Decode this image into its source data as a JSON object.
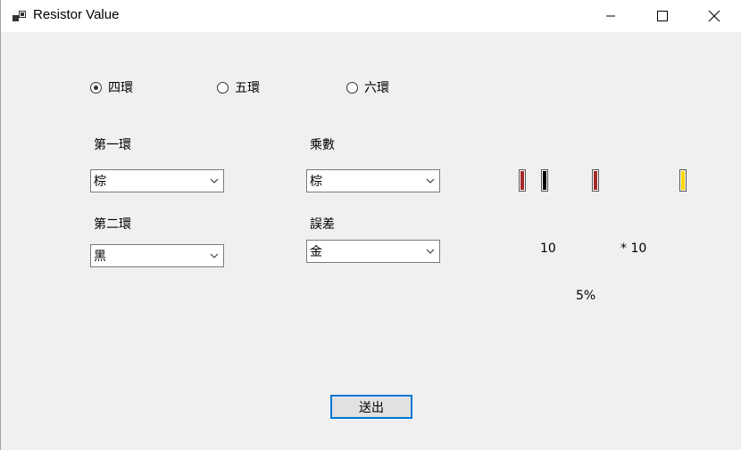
{
  "window": {
    "title": "Resistor Value"
  },
  "band_mode": {
    "options": [
      {
        "label": "四環",
        "checked": true
      },
      {
        "label": "五環",
        "checked": false
      },
      {
        "label": "六環",
        "checked": false
      }
    ]
  },
  "fields": {
    "band1": {
      "label": "第一環",
      "value": "棕"
    },
    "band2": {
      "label": "第二環",
      "value": "黑"
    },
    "multiplier": {
      "label": "乘數",
      "value": "棕"
    },
    "tolerance": {
      "label": "誤差",
      "value": "金"
    }
  },
  "bands_preview": {
    "colors": [
      "#a52a2a",
      "#000000",
      "#a52a2a",
      "#ffd700"
    ]
  },
  "results": {
    "base": "10",
    "multiplier": "* 10",
    "tolerance": "5%"
  },
  "actions": {
    "submit_label": "送出"
  },
  "icons": {
    "app": "app-window-icon",
    "minimize": "minimize-icon",
    "maximize": "maximize-icon",
    "close": "close-icon",
    "dropdown": "chevron-down-icon"
  }
}
